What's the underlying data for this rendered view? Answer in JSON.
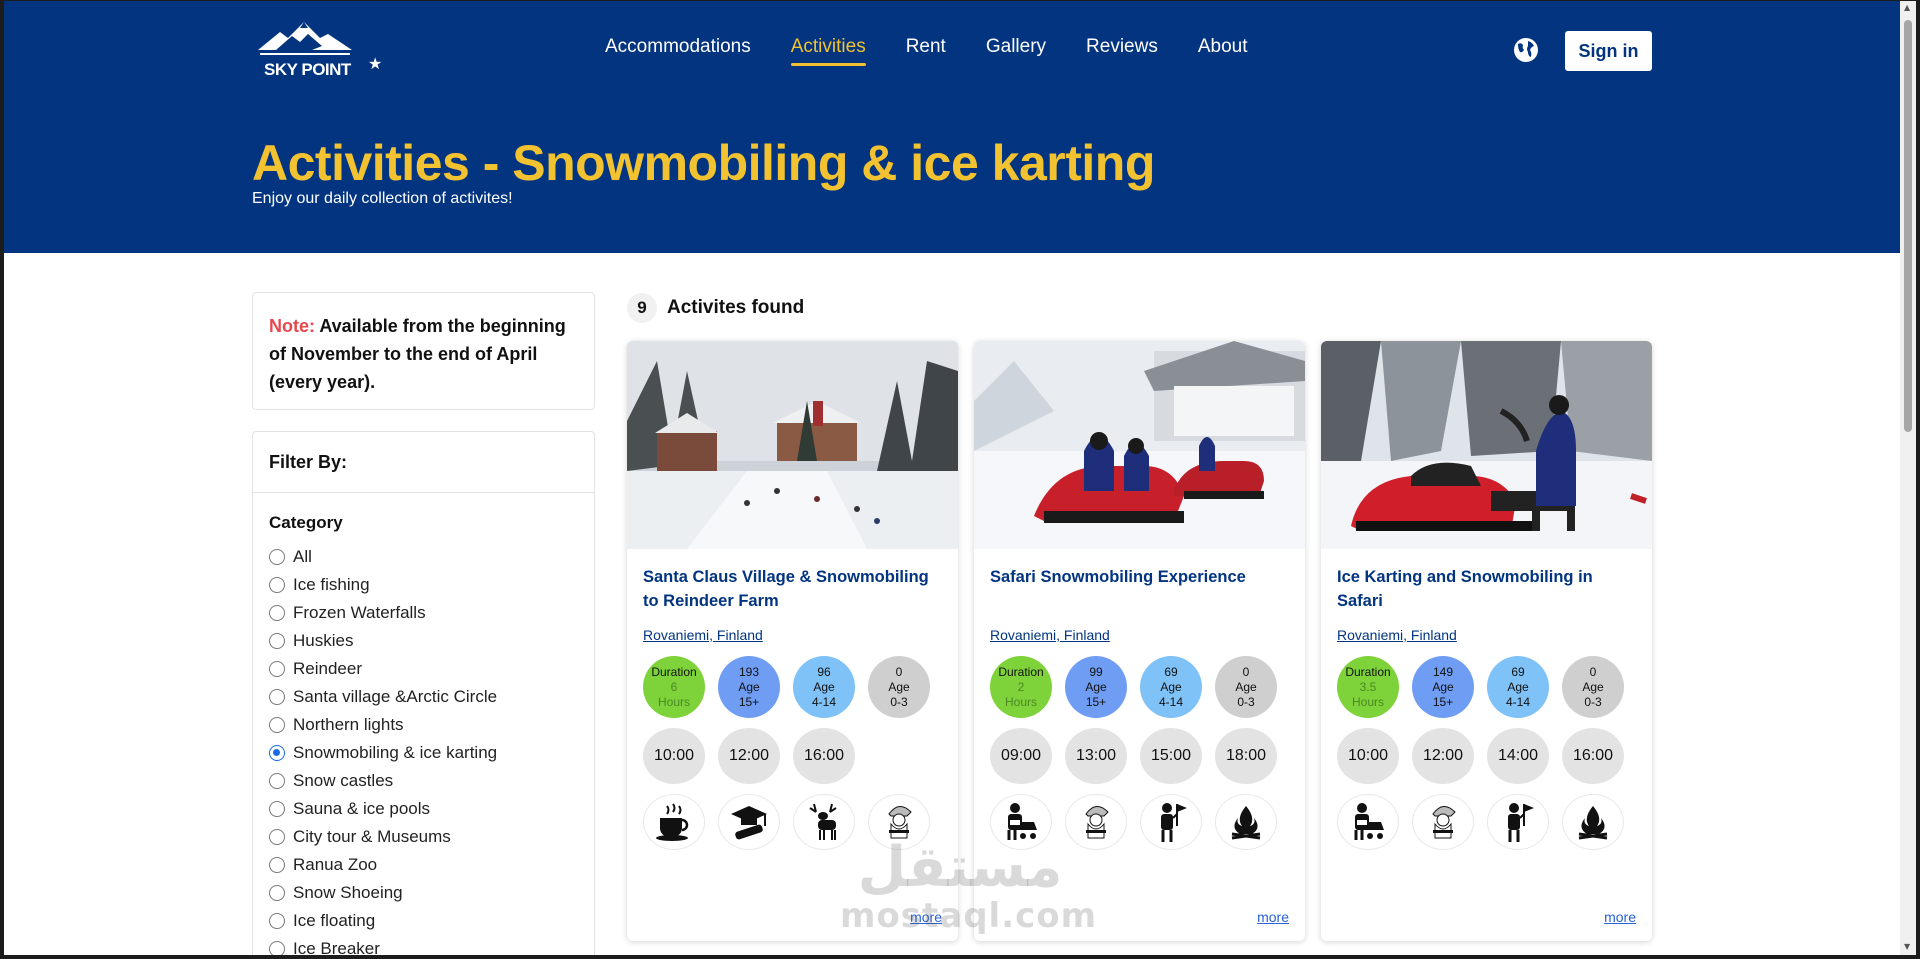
{
  "brand": {
    "name": "SKY POINT"
  },
  "nav": {
    "items": [
      "Accommodations",
      "Activities",
      "Rent",
      "Gallery",
      "Reviews",
      "About"
    ],
    "active": "Activities",
    "signin_label": "Sign in"
  },
  "hero": {
    "title": "Activities - Snowmobiling & ice karting",
    "subtitle": "Enjoy our daily collection of activites!"
  },
  "note": {
    "label": "Note:",
    "text": " Available from the beginning of November to the end of April (every year)."
  },
  "filter": {
    "heading": "Filter By:",
    "category_title": "Category",
    "categories": [
      "All",
      "Ice fishing",
      "Frozen Waterfalls",
      "Huskies",
      "Reindeer",
      "Santa village &Arctic Circle",
      "Northern lights",
      "Snowmobiling & ice karting",
      "Snow castles",
      "Sauna & ice pools",
      "City tour & Museums",
      "Ranua Zoo",
      "Snow Shoeing",
      "Ice floating",
      "Ice Breaker"
    ],
    "selected": "Snowmobiling & ice karting"
  },
  "results": {
    "count": "9",
    "count_label": "Activites found"
  },
  "cards": [
    {
      "title": "Santa Claus Village & Snowmobiling to Reindeer Farm",
      "location": "Rovaniemi, Finland",
      "duration_label": "Duration",
      "duration_value": "6",
      "duration_unit": "Hours",
      "price_15": "193",
      "label_15": "Age",
      "range_15": "15+",
      "price_4": "96",
      "label_4": "Age",
      "range_4": "4-14",
      "price_0": "0",
      "label_0": "Age",
      "range_0": "0-3",
      "times": [
        "10:00",
        "12:00",
        "16:00"
      ],
      "icons": [
        "coffee-cup-icon",
        "graduation-diploma-icon",
        "reindeer-icon",
        "santa-claus-icon"
      ],
      "more_label": "more"
    },
    {
      "title": "Safari Snowmobiling Experience",
      "location": "Rovaniemi, Finland",
      "duration_label": "Duration",
      "duration_value": "2",
      "duration_unit": "Hours",
      "price_15": "99",
      "label_15": "Age",
      "range_15": "15+",
      "price_4": "69",
      "label_4": "Age",
      "range_4": "4-14",
      "price_0": "0",
      "label_0": "Age",
      "range_0": "0-3",
      "times": [
        "09:00",
        "13:00",
        "15:00",
        "18:00"
      ],
      "icons": [
        "driver-pickup-icon",
        "santa-claus-icon",
        "guide-flag-icon",
        "campfire-icon"
      ],
      "more_label": "more"
    },
    {
      "title": "Ice Karting and Snowmobiling in Safari",
      "location": "Rovaniemi, Finland",
      "duration_label": "Duration",
      "duration_value": "3.5",
      "duration_unit": "Hours",
      "price_15": "149",
      "label_15": "Age",
      "range_15": "15+",
      "price_4": "69",
      "label_4": "Age",
      "range_4": "4-14",
      "price_0": "0",
      "label_0": "Age",
      "range_0": "0-3",
      "times": [
        "10:00",
        "12:00",
        "14:00",
        "16:00"
      ],
      "icons": [
        "driver-pickup-icon",
        "santa-claus-icon",
        "guide-flag-icon",
        "campfire-icon"
      ],
      "more_label": "more"
    }
  ],
  "watermark": {
    "arabic": "مستقل",
    "latin": "mostaql.com"
  },
  "colors": {
    "header_bg": "#023480",
    "accent_yellow": "#f2c230",
    "note_red": "#e5484d",
    "link_blue": "#023480",
    "duration_green": "#7ed23a",
    "age_adult_blue": "#6f9df3",
    "age_child_blue": "#7fc2f7",
    "age_infant_gray": "#cfcfcf"
  }
}
